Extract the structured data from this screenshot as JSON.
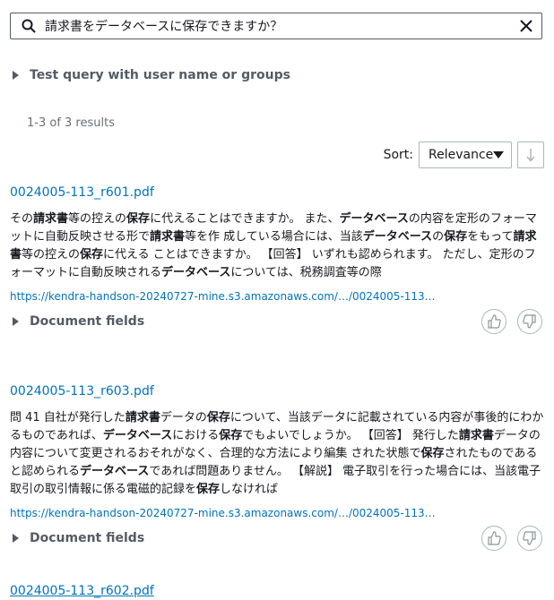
{
  "search": {
    "value": "請求書をデータベースに保存できますか？",
    "placeholder": ""
  },
  "test_query": {
    "label": "Test query with user name or groups"
  },
  "results_count": "1-3 of 3 results",
  "sort": {
    "label": "Sort:",
    "selected": "Relevance"
  },
  "results": [
    {
      "title": "0024005-113_r601.pdf",
      "excerpt": [
        {
          "t": "その"
        },
        {
          "t": "請求書",
          "b": true
        },
        {
          "t": "等の控えの"
        },
        {
          "t": "保存",
          "b": true
        },
        {
          "t": "に代えることはできますか。 また、"
        },
        {
          "t": "データベース",
          "b": true
        },
        {
          "t": "の内容を定形のフォーマットに自動反映させる形で"
        },
        {
          "t": "請求書",
          "b": true
        },
        {
          "t": "等を作 成している場合には、当該"
        },
        {
          "t": "データベース",
          "b": true
        },
        {
          "t": "の"
        },
        {
          "t": "保存",
          "b": true
        },
        {
          "t": "をもって"
        },
        {
          "t": "請求書",
          "b": true
        },
        {
          "t": "等の控えの"
        },
        {
          "t": "保存",
          "b": true
        },
        {
          "t": "に代える ことはできますか。 【回答】 いずれも認められます。 ただし、定形のフォーマットに自動反映される"
        },
        {
          "t": "データベース",
          "b": true
        },
        {
          "t": "については、税務調査等の際"
        }
      ],
      "url": "https://kendra-handson-20240727-mine.s3.amazonaws.com/…/0024005-113…",
      "fields_label": "Document fields"
    },
    {
      "title": "0024005-113_r603.pdf",
      "excerpt": [
        {
          "t": "問 41 自社が発行した"
        },
        {
          "t": "請求書",
          "b": true
        },
        {
          "t": "データの"
        },
        {
          "t": "保存",
          "b": true
        },
        {
          "t": "について、当該データに記載されている内容が事後的にわかるものであれば、"
        },
        {
          "t": "データベース",
          "b": true
        },
        {
          "t": "における"
        },
        {
          "t": "保存",
          "b": true
        },
        {
          "t": "でもよいでしょうか。 【回答】 発行した"
        },
        {
          "t": "請求書",
          "b": true
        },
        {
          "t": "データの内容について変更されるおそれがなく、合理的な方法により編集 された状態で"
        },
        {
          "t": "保存",
          "b": true
        },
        {
          "t": "されたものであると認められる"
        },
        {
          "t": "データベース",
          "b": true
        },
        {
          "t": "であれば問題ありません。 【解説】 電子取引を行った場合には、当該電子取引の取引情報に係る電磁的記録を"
        },
        {
          "t": "保存",
          "b": true
        },
        {
          "t": "しなければ"
        }
      ],
      "url": "https://kendra-handson-20240727-mine.s3.amazonaws.com/…/0024005-113…",
      "fields_label": "Document fields"
    },
    {
      "title": "0024005-113_r602.pdf"
    }
  ]
}
